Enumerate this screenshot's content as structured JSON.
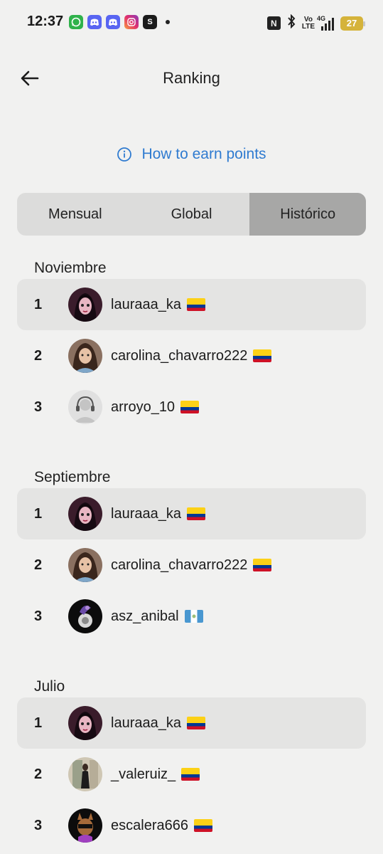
{
  "status_bar": {
    "time": "12:37",
    "apps": [
      "whatsapp-icon",
      "discord-icon",
      "discord-icon",
      "instagram-icon",
      "app-s-icon"
    ],
    "app_s_letter": "S",
    "volte_top": "Vo",
    "volte_bottom": "LTE",
    "network": "4G",
    "battery": "27"
  },
  "header": {
    "title": "Ranking"
  },
  "earn_link": {
    "label": "How to earn points"
  },
  "tabs": [
    {
      "label": "Mensual",
      "active": false
    },
    {
      "label": "Global",
      "active": false
    },
    {
      "label": "Histórico",
      "active": true
    }
  ],
  "sections": [
    {
      "title": "Noviembre",
      "rows": [
        {
          "rank": "1",
          "username": "lauraaa_ka",
          "flag": "colombia"
        },
        {
          "rank": "2",
          "username": "carolina_chavarro222",
          "flag": "colombia"
        },
        {
          "rank": "3",
          "username": "arroyo_10",
          "flag": "colombia"
        }
      ]
    },
    {
      "title": "Septiembre",
      "rows": [
        {
          "rank": "1",
          "username": "lauraaa_ka",
          "flag": "colombia"
        },
        {
          "rank": "2",
          "username": "carolina_chavarro222",
          "flag": "colombia"
        },
        {
          "rank": "3",
          "username": "asz_anibal",
          "flag": "guatemala"
        }
      ]
    },
    {
      "title": "Julio",
      "rows": [
        {
          "rank": "1",
          "username": "lauraaa_ka",
          "flag": "colombia"
        },
        {
          "rank": "2",
          "username": "_valeruiz_",
          "flag": "colombia"
        },
        {
          "rank": "3",
          "username": "escalera666",
          "flag": "colombia"
        }
      ]
    }
  ],
  "colors": {
    "background": "#f1f1f0",
    "link": "#2f7bd0",
    "tab_active": "#a7a7a6",
    "tab_bg": "#dcdcdb",
    "row_highlight": "#e4e4e3",
    "battery": "#d5b33a"
  }
}
